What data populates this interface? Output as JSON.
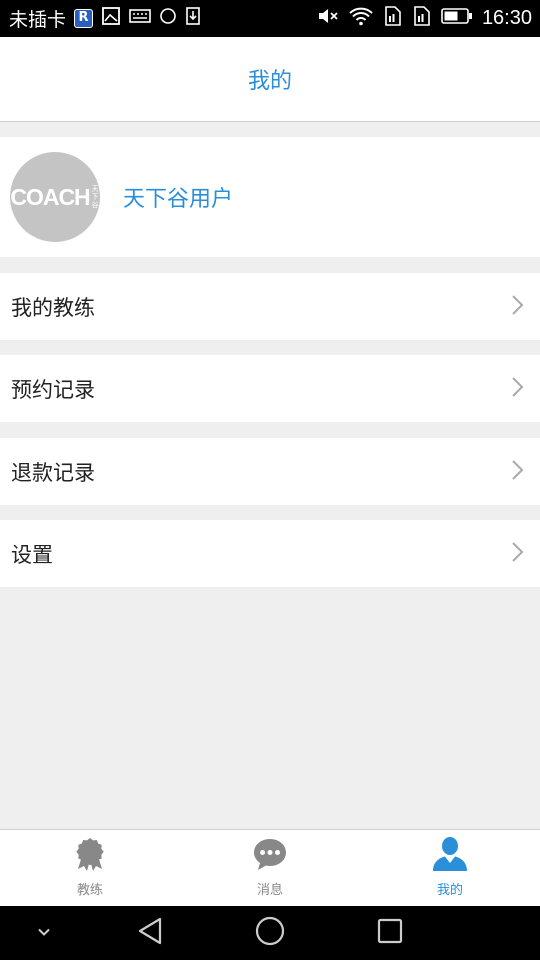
{
  "status_bar": {
    "carrier": "未插卡",
    "r_badge": "R",
    "time": "16:30",
    "icons": [
      "r-badge-icon",
      "image-icon",
      "keyboard-icon",
      "circle-icon",
      "download-icon",
      "mute-icon",
      "wifi-icon",
      "sim1-icon",
      "sim2-icon",
      "battery-icon"
    ]
  },
  "header": {
    "title": "我的"
  },
  "profile": {
    "avatar_text": "COACH",
    "avatar_sub": "天下谷",
    "username": "天下谷用户"
  },
  "menu": [
    {
      "label": "我的教练"
    },
    {
      "label": "预约记录"
    },
    {
      "label": "退款记录"
    },
    {
      "label": "设置"
    }
  ],
  "tabs": [
    {
      "label": "教练",
      "icon": "medal-icon"
    },
    {
      "label": "消息",
      "icon": "chat-icon"
    },
    {
      "label": "我的",
      "icon": "user-icon"
    }
  ],
  "colors": {
    "accent": "#2a8fd8",
    "inactive": "#888888",
    "background": "#efefef"
  }
}
